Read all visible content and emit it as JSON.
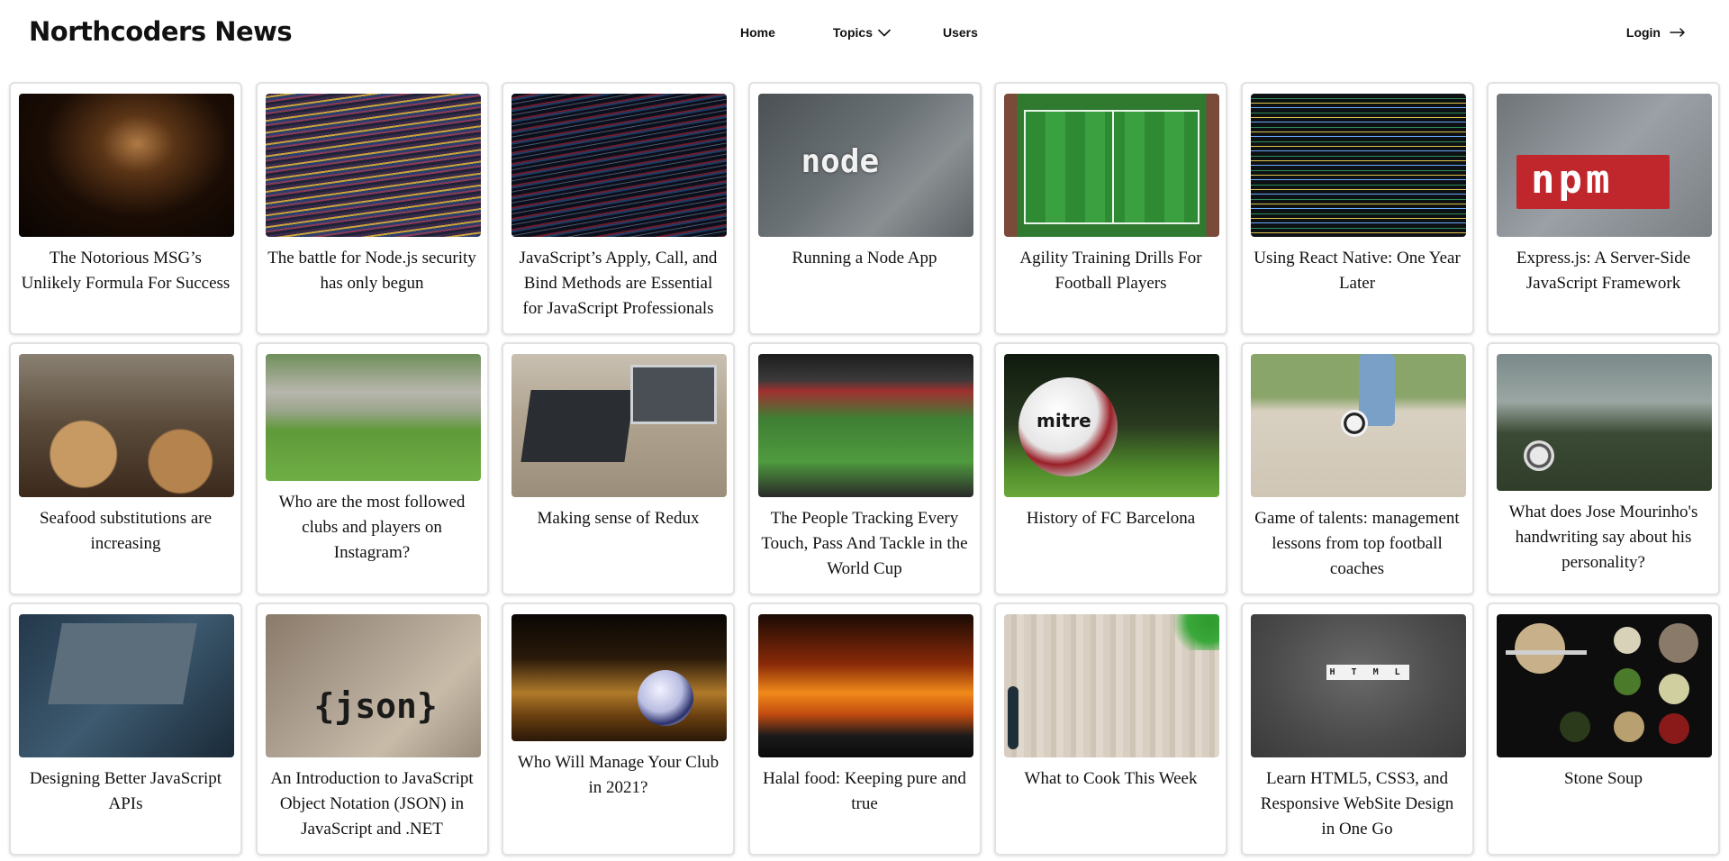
{
  "brand": "Northcoders News",
  "nav": {
    "home": "Home",
    "topics": "Topics",
    "users": "Users",
    "login": "Login"
  },
  "articles": [
    {
      "title": "The Notorious MSG’s Unlikely Formula For Success",
      "image": "cooking-pan-photo"
    },
    {
      "title": "The battle for Node.js security has only begun",
      "image": "code-screen-photo"
    },
    {
      "title": "JavaScript’s Apply, Call, and Bind Methods are Essential for JavaScript Professionals",
      "image": "code-screen-photo"
    },
    {
      "title": "Running a Node App",
      "image": "node-logo-photo",
      "image_text": "node"
    },
    {
      "title": "Agility Training Drills For Football Players",
      "image": "football-pitch-photo"
    },
    {
      "title": "Using React Native: One Year Later",
      "image": "code-editor-photo"
    },
    {
      "title": "Express.js: A Server-Side JavaScript Framework",
      "image": "npm-sticker-photo",
      "image_text": "npm"
    },
    {
      "title": "Seafood substitutions are increasing",
      "image": "seafood-plating-photo"
    },
    {
      "title": "Who are the most followed clubs and players on Instagram?",
      "image": "football-match-photo"
    },
    {
      "title": "Making sense of Redux",
      "image": "laptops-desk-photo"
    },
    {
      "title": "The People Tracking Every Touch, Pass And Tackle in the World Cup",
      "image": "stadium-photo"
    },
    {
      "title": "History of FC Barcelona",
      "image": "football-grass-photo",
      "image_text": "mitre"
    },
    {
      "title": "Game of talents: management lessons from top football coaches",
      "image": "kicking-ball-photo"
    },
    {
      "title": "What does Jose Mourinho's handwriting say about his personality?",
      "image": "ball-field-dusk-photo"
    },
    {
      "title": "Designing Better JavaScript APIs",
      "image": "laptop-dark-photo"
    },
    {
      "title": "An Introduction to JavaScript Object Notation (JSON) in JavaScript and .NET",
      "image": "json-sticker-photo",
      "image_text": "{json}"
    },
    {
      "title": "Who Will Manage Your Club in 2021?",
      "image": "ball-sunset-photo"
    },
    {
      "title": "Halal food: Keeping pure and true",
      "image": "cooking-fire-photo"
    },
    {
      "title": "What to Cook This Week",
      "image": "wood-board-photo"
    },
    {
      "title": "Learn HTML5, CSS3, and Responsive WebSite Design in One Go",
      "image": "html-tiles-photo",
      "image_text": "H T M L"
    },
    {
      "title": "Stone Soup",
      "image": "kitchen-flatlay-photo"
    }
  ],
  "colors": {
    "text": "#111111",
    "card_border": "#e2e2e2",
    "background": "#ffffff"
  }
}
